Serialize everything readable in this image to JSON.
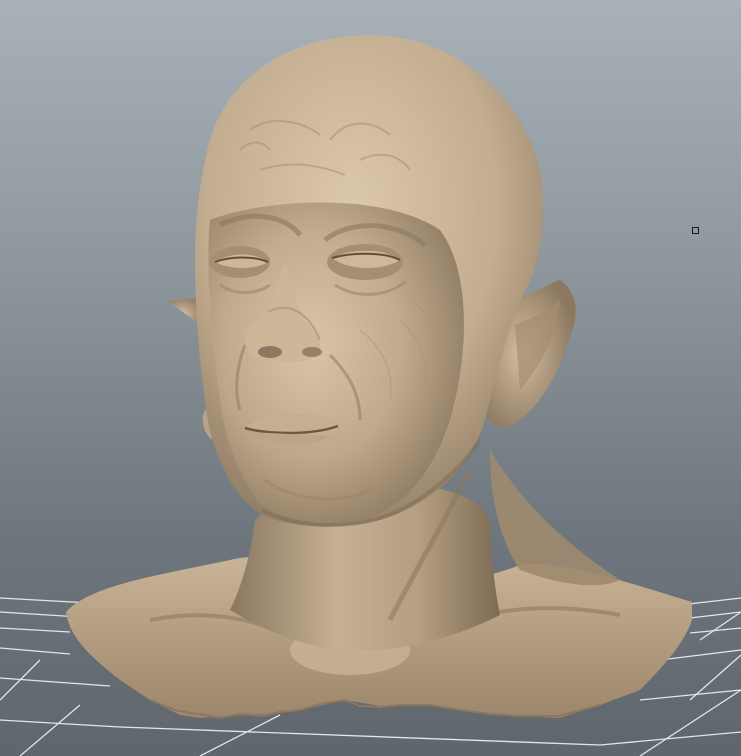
{
  "viewport": {
    "background_top": "#a9b1b8",
    "background_bottom": "#5f666c",
    "grid_color": "#e8ecef",
    "model": {
      "kind": "head-and-shoulders sculpt",
      "skin_light": "#d8c4a8",
      "skin_mid": "#b39f84",
      "skin_dark": "#6e5d48"
    },
    "pivot_marker_icon": "square-outline-icon"
  }
}
